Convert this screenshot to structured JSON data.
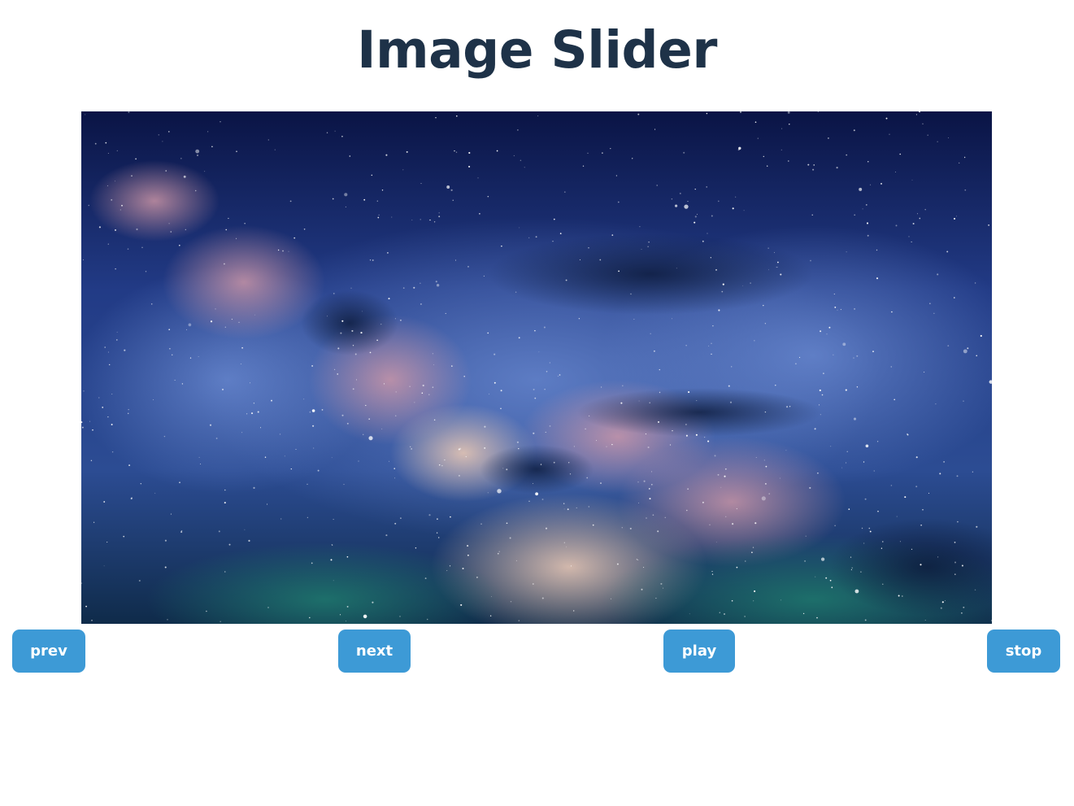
{
  "header": {
    "title": "Image Slider"
  },
  "slider": {
    "image_subject": "milky-way-night-sky",
    "colors": {
      "sky_deep": "#0b1646",
      "sky_mid": "#3a56a8",
      "nebula_pink": "#c9869a",
      "horizon_teal": "#1f6a66"
    }
  },
  "controls": {
    "prev_label": "prev",
    "next_label": "next",
    "play_label": "play",
    "stop_label": "stop",
    "button_color": "#3d9ad6"
  }
}
